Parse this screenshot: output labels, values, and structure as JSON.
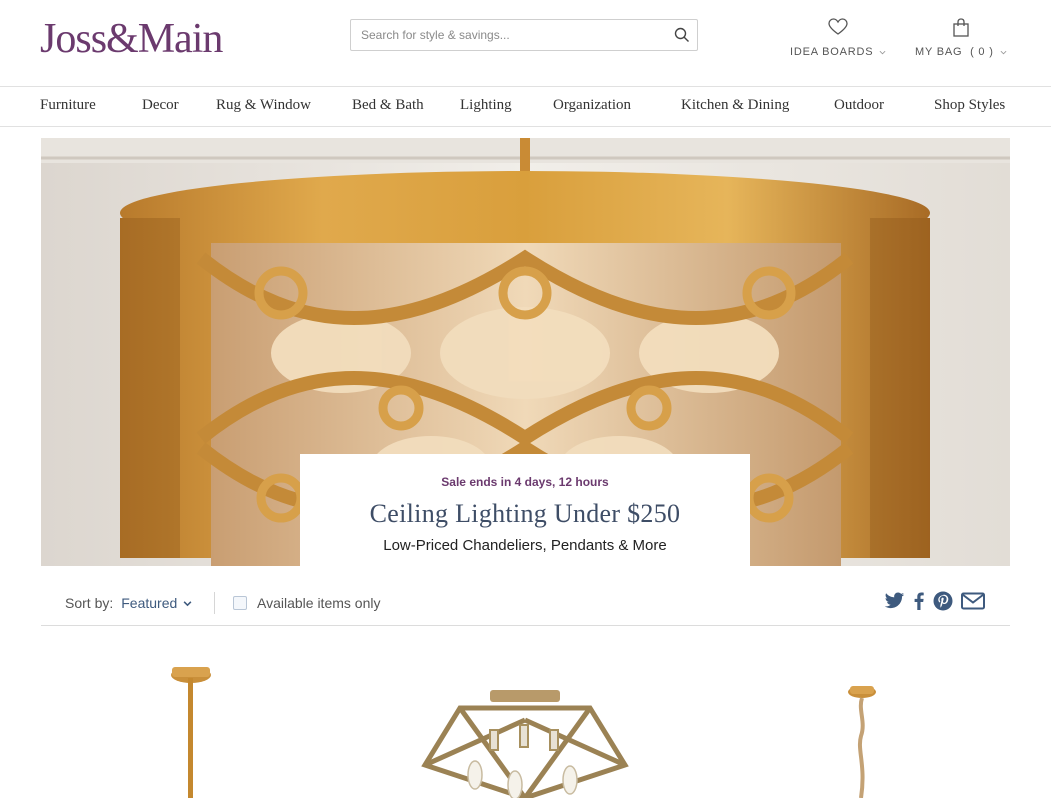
{
  "header": {
    "logo": "Joss&Main",
    "search_placeholder": "Search for style & savings...",
    "idea_boards": "IDEA BOARDS",
    "my_bag": "MY BAG  ( 0 )"
  },
  "nav": {
    "items": [
      "Furniture",
      "Decor",
      "Rug & Window",
      "Bed & Bath",
      "Lighting",
      "Organization",
      "Kitchen & Dining",
      "Outdoor",
      "Shop Styles"
    ]
  },
  "hero": {
    "sale": "Sale ends in 4 days, 12 hours",
    "title": "Ceiling Lighting Under $250",
    "subtitle": "Low-Priced Chandeliers, Pendants & More"
  },
  "toolbar": {
    "sort_label": "Sort by:",
    "sort_value": "Featured",
    "available_label": "Available items only"
  },
  "icons": [
    "heart-icon",
    "bag-icon",
    "search-icon",
    "chevron-down-icon",
    "twitter-icon",
    "facebook-icon",
    "pinterest-icon",
    "email-icon"
  ],
  "colors": {
    "brand": "#6b3a6e",
    "title": "#3e4d66",
    "link": "#3e5a7e",
    "social": "#3e5a7e"
  }
}
